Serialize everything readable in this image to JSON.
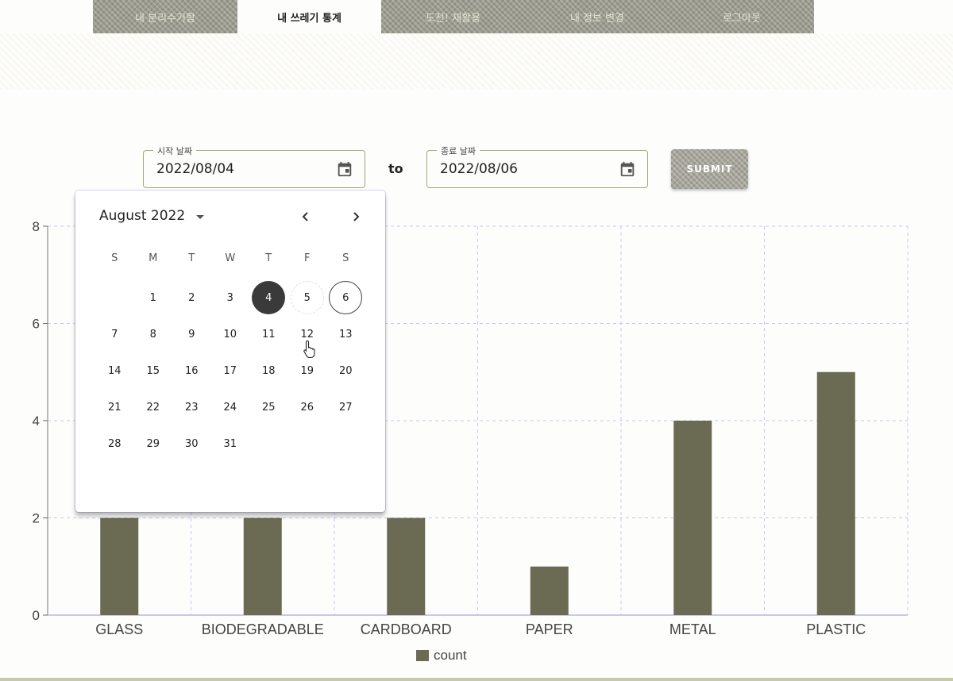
{
  "nav": {
    "items": [
      "내 분리수거함",
      "내 쓰레기 통계",
      "도전! 재활용",
      "내 정보 변경",
      "로그아웃"
    ],
    "active_index": 1
  },
  "start_date": {
    "label": "시작 날짜",
    "value": "2022/08/04"
  },
  "to_label": "to",
  "end_date": {
    "label": "종료 날짜",
    "value": "2022/08/06"
  },
  "submit_label": "SUBMIT",
  "picker": {
    "month_label": "August 2022",
    "weekdays": [
      "S",
      "M",
      "T",
      "W",
      "T",
      "F",
      "S"
    ],
    "first_weekday_offset": 1,
    "days_in_month": 31,
    "selected_day": 4,
    "range_end_day": 6,
    "hover_day": 5
  },
  "colors": {
    "bar": "#6b6a52",
    "grid": "#c8c8f0",
    "axis": "#b8b8e0",
    "accent": "#3a3a3a"
  },
  "chart_data": {
    "type": "bar",
    "categories": [
      "GLASS",
      "BIODEGRADABLE",
      "CARDBOARD",
      "PAPER",
      "METAL",
      "PLASTIC"
    ],
    "series": [
      {
        "name": "count",
        "values": [
          2,
          2,
          2,
          1,
          4,
          5
        ]
      }
    ],
    "ylim": [
      0,
      8
    ],
    "yticks": [
      0,
      2,
      4,
      6,
      8
    ],
    "grid": true,
    "legend_position": "bottom"
  }
}
